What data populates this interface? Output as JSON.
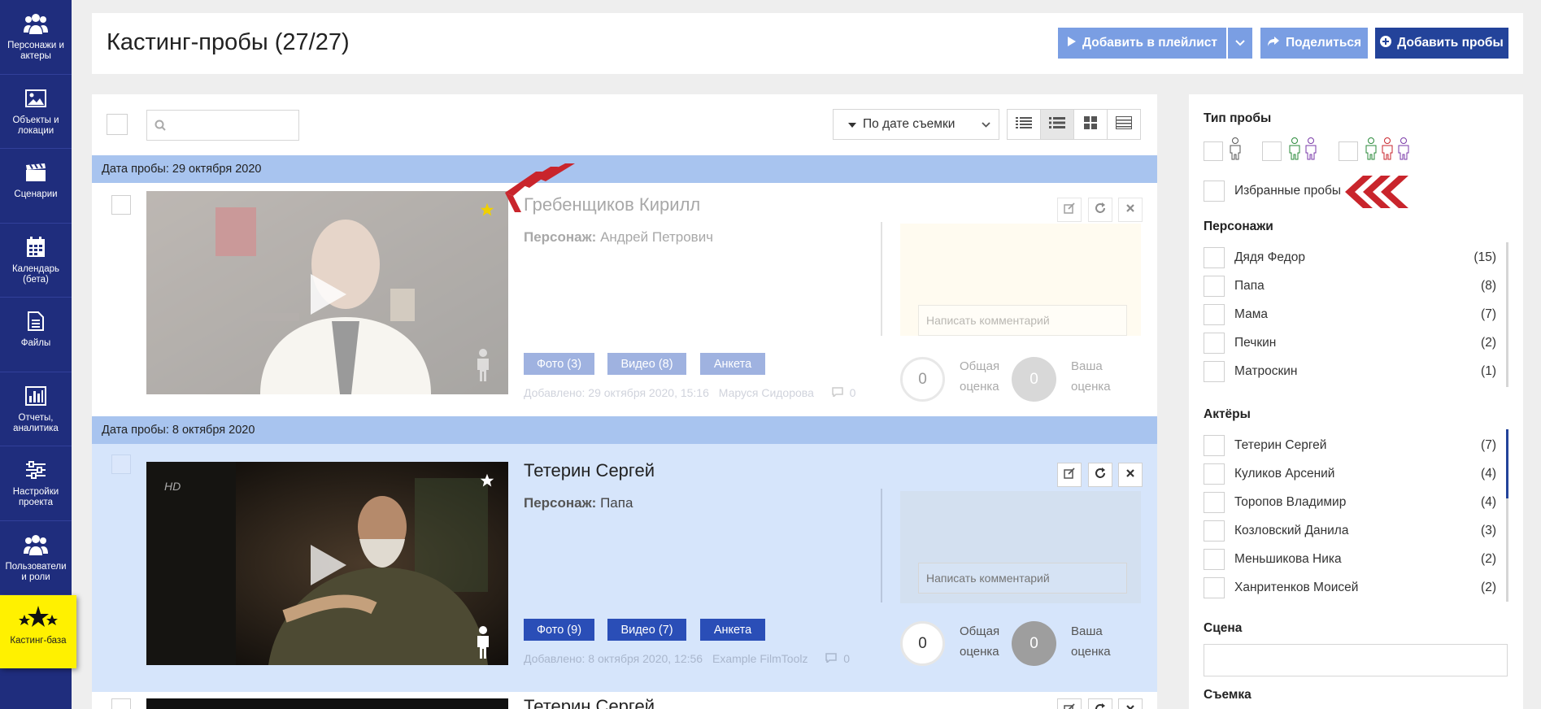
{
  "sidebar": {
    "items": [
      {
        "label": "Персонажи и актеры",
        "icon": "people-icon"
      },
      {
        "label": "Объекты и локации",
        "icon": "image-icon"
      },
      {
        "label": "Сценарии",
        "icon": "clapperboard-icon"
      },
      {
        "label": "Календарь (бета)",
        "icon": "calendar-icon"
      },
      {
        "label": "Файлы",
        "icon": "file-icon"
      },
      {
        "label": "Отчеты, аналитика",
        "icon": "bar-chart-icon"
      },
      {
        "label": "Настройки проекта",
        "icon": "sliders-icon"
      },
      {
        "label": "Пользователи и роли",
        "icon": "users-icon"
      },
      {
        "label": "Кастинг-база",
        "icon": "stars-icon",
        "active": true
      }
    ]
  },
  "header": {
    "title": "Кастинг-пробы (27/27)",
    "add_to_playlist": "Добавить в плейлист",
    "share": "Поделиться",
    "add_tests": "Добавить пробы"
  },
  "toolbar": {
    "search_placeholder": "",
    "sort_label": "По дате съемки",
    "view_modes": [
      "list-compact-icon",
      "list-icon",
      "grid-icon",
      "table-icon"
    ],
    "active_view": 1
  },
  "groups": [
    {
      "date_label": "Дата пробы: 29 октября 2020"
    },
    {
      "date_label": "Дата пробы: 8 октября 2020"
    }
  ],
  "cards": [
    {
      "name": "Гребенщиков Кирилл",
      "role_label": "Персонаж:",
      "role": "Андрей Петрович",
      "photo_btn": "Фото (3)",
      "video_btn": "Видео (8)",
      "form_btn": "Анкета",
      "added": "Добавлено: 29 октября 2020, 15:16",
      "author": "Маруся Сидорова",
      "comments": "0",
      "comment_placeholder": "Написать комментарий",
      "total_score": "0",
      "total_label_1": "Общая",
      "total_label_2": "оценка",
      "your_score": "0",
      "your_label_1": "Ваша",
      "your_label_2": "оценка",
      "favorite": true
    },
    {
      "name": "Тетерин Сергей",
      "role_label": "Персонаж:",
      "role": "Папа",
      "photo_btn": "Фото (9)",
      "video_btn": "Видео (7)",
      "form_btn": "Анкета",
      "added": "Добавлено: 8 октября 2020, 12:56",
      "author": "Example FilmToolz",
      "comments": "0",
      "comment_placeholder": "Написать комментарий",
      "total_score": "0",
      "total_label_1": "Общая",
      "total_label_2": "оценка",
      "your_score": "0",
      "your_label_1": "Ваша",
      "your_label_2": "оценка",
      "favorite": false
    },
    {
      "name": "Тетерин Сергей"
    }
  ],
  "filters": {
    "test_type_title": "Тип пробы",
    "favorites_label": "Избранные пробы",
    "characters_title": "Персонажи",
    "characters": [
      {
        "name": "Дядя Федор",
        "count": "(15)"
      },
      {
        "name": "Папа",
        "count": "(8)"
      },
      {
        "name": "Мама",
        "count": "(7)"
      },
      {
        "name": "Печкин",
        "count": "(2)"
      },
      {
        "name": "Матроскин",
        "count": "(1)"
      }
    ],
    "actors_title": "Актёры",
    "actors": [
      {
        "name": "Тетерин Сергей",
        "count": "(7)"
      },
      {
        "name": "Куликов Арсений",
        "count": "(4)"
      },
      {
        "name": "Торопов Владимир",
        "count": "(4)"
      },
      {
        "name": "Козловский Данила",
        "count": "(3)"
      },
      {
        "name": "Меньшикова Ника",
        "count": "(2)"
      },
      {
        "name": "Ханритенков Моисей",
        "count": "(2)"
      }
    ],
    "scene_title": "Сцена",
    "shooting_title": "Съемка"
  },
  "colors": {
    "sidebar_bg": "#1f2d7d",
    "active_nav": "#fff100",
    "primary": "#23439a",
    "light_button": "#7a9ee3",
    "group_header": "#a8c4ef",
    "selected_card": "#d6e5fb",
    "arrow_red": "#c9252c"
  }
}
